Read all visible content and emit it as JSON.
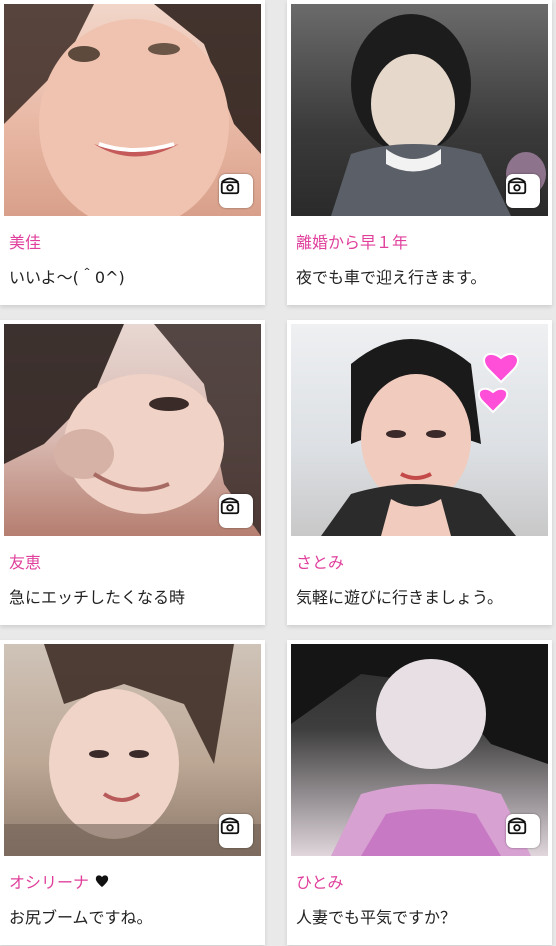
{
  "accent_colors": {
    "name_pink": "#e0409c",
    "message_text": "#222222",
    "page_bg": "#e9e9e9",
    "card_bg": "#ffffff"
  },
  "profiles": [
    {
      "name": "美佳",
      "message": "いいよ〜(＾0^)",
      "phone_icon": "phone-icon",
      "photo_icon": "profile-photo"
    },
    {
      "name": "離婚から早１年",
      "message": "夜でも車で迎え行きます。",
      "phone_icon": "phone-icon",
      "photo_icon": "profile-photo"
    },
    {
      "name": "友恵",
      "message": "急にエッチしたくなる時",
      "phone_icon": "phone-icon",
      "photo_icon": "profile-photo"
    },
    {
      "name": "さとみ",
      "message": "気軽に遊びに行きましょう。",
      "photo_icon": "profile-photo",
      "decoration_icon": "pink-heart-icon"
    },
    {
      "name": "オシリーナ",
      "message": "お尻ブームですね。",
      "phone_icon": "phone-icon",
      "photo_icon": "profile-photo",
      "name_icon": "black-heart-icon"
    },
    {
      "name": "ひとみ",
      "message": "人妻でも平気ですか？",
      "phone_icon": "phone-icon",
      "photo_icon": "profile-photo"
    }
  ]
}
